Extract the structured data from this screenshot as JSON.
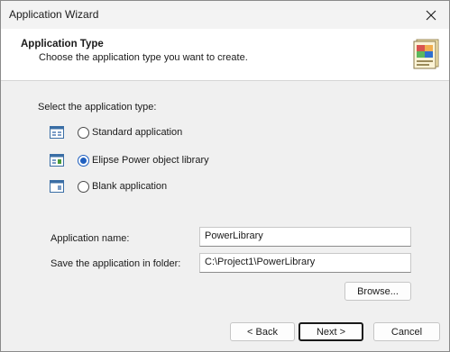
{
  "window": {
    "title": "Application Wizard",
    "close_icon": "close-icon"
  },
  "header": {
    "title": "Application Type",
    "subtitle": "Choose the application type you want to create.",
    "icon": "wizard-icon"
  },
  "app_type": {
    "prompt": "Select the application type:",
    "options": [
      {
        "label": "Standard application",
        "checked": false,
        "icon": "application-icon"
      },
      {
        "label": "Elipse Power object library",
        "checked": true,
        "icon": "object-library-icon"
      },
      {
        "label": "Blank application",
        "checked": false,
        "icon": "blank-application-icon"
      }
    ]
  },
  "fields": {
    "app_name_label": "Application name:",
    "app_name_value": "PowerLibrary",
    "folder_label": "Save the application in folder:",
    "folder_value": "C:\\Project1\\PowerLibrary",
    "browse_label": "Browse..."
  },
  "buttons": {
    "back": "< Back",
    "next": "Next >",
    "cancel": "Cancel"
  },
  "colors": {
    "accent": "#1f5fbf",
    "header_bg": "#ffffff",
    "dialog_bg": "#f0f0f0"
  }
}
